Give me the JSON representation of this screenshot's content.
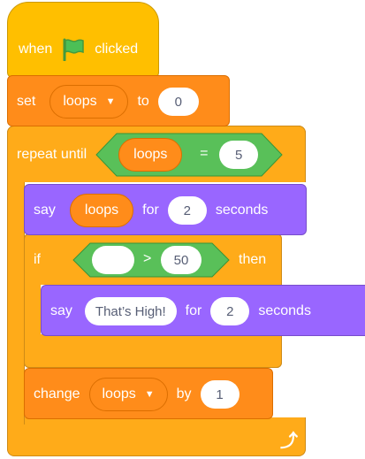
{
  "colors": {
    "events": "#FFBF00",
    "control": "#FFAB19",
    "variables": "#FF8C1A",
    "looks": "#9966FF",
    "operators": "#59C059",
    "flag": "#4CBF56"
  },
  "hat": {
    "when": "when",
    "clicked": "clicked",
    "icon": "green-flag-icon"
  },
  "set_block": {
    "set": "set",
    "variable": "loops",
    "to": "to",
    "value": "0"
  },
  "repeat_block": {
    "label": "repeat until",
    "condition": {
      "variable": "loops",
      "operator": "=",
      "value": "5"
    },
    "loop_icon": "loop-arrow-icon"
  },
  "say_loops": {
    "say": "say",
    "variable": "loops",
    "for": "for",
    "secs": "2",
    "seconds": "seconds"
  },
  "if_block": {
    "if": "if",
    "left_value": "",
    "operator": ">",
    "right_value": "50",
    "then": "then"
  },
  "say_high": {
    "say": "say",
    "message": "That’s High!",
    "for": "for",
    "secs": "2",
    "seconds": "seconds"
  },
  "change_block": {
    "change": "change",
    "variable": "loops",
    "by": "by",
    "value": "1"
  }
}
